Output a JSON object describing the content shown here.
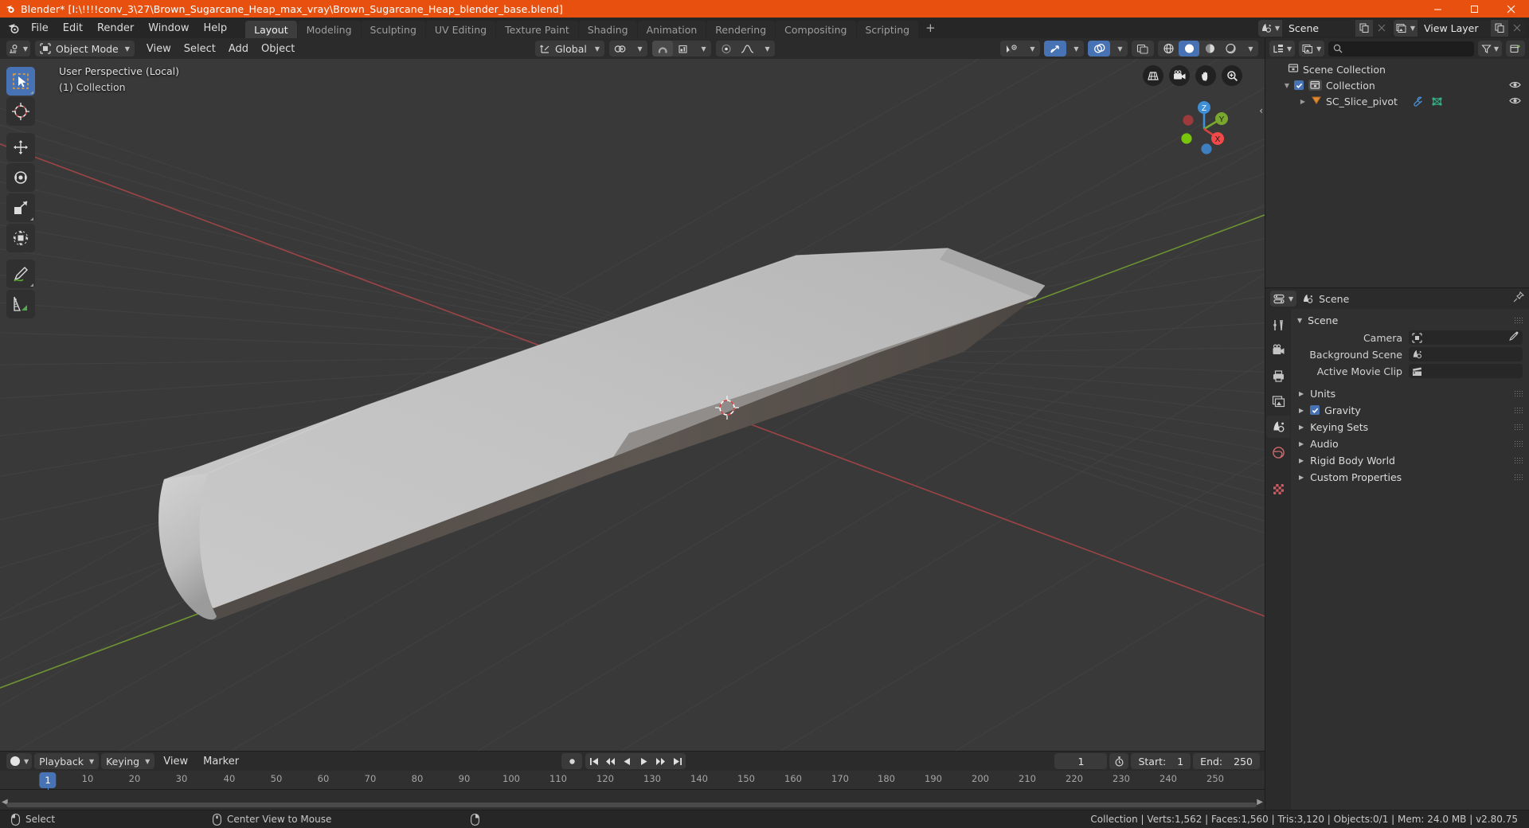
{
  "window": {
    "title": "Blender* [I:\\!!!!conv_3\\27\\Brown_Sugarcane_Heap_max_vray\\Brown_Sugarcane_Heap_blender_base.blend]",
    "minimize": "–",
    "maximize": "▢",
    "close": "✕"
  },
  "topbar": {
    "menus": [
      "File",
      "Edit",
      "Render",
      "Window",
      "Help"
    ],
    "workspaces": [
      {
        "label": "Layout",
        "active": true
      },
      {
        "label": "Modeling",
        "active": false
      },
      {
        "label": "Sculpting",
        "active": false
      },
      {
        "label": "UV Editing",
        "active": false
      },
      {
        "label": "Texture Paint",
        "active": false
      },
      {
        "label": "Shading",
        "active": false
      },
      {
        "label": "Animation",
        "active": false
      },
      {
        "label": "Rendering",
        "active": false
      },
      {
        "label": "Compositing",
        "active": false
      },
      {
        "label": "Scripting",
        "active": false
      }
    ],
    "add_workspace": "+",
    "scene_name": "Scene",
    "view_layer_name": "View Layer"
  },
  "viewport": {
    "mode": "Object Mode",
    "menus": [
      "View",
      "Select",
      "Add",
      "Object"
    ],
    "transform_orientation": "Global",
    "overlay_line1": "User Perspective (Local)",
    "overlay_line2": "(1) Collection",
    "gizmo_axes": [
      "X",
      "Y",
      "Z"
    ],
    "background_color": "#393939",
    "grid_color": "#4a4a4a",
    "x_axis_color": "#b34040",
    "y_axis_color": "#6e9e2e",
    "object_light_color": "#c3c3c3",
    "object_dark_color": "#58524e",
    "cursor_label": "3d-cursor"
  },
  "outliner": {
    "search_placeholder": "",
    "rows": [
      {
        "label": "Scene Collection",
        "indent": 0,
        "icon": "collection-icon",
        "has_eye": false,
        "has_checkbox": false,
        "has_disclosure": false
      },
      {
        "label": "Collection",
        "indent": 1,
        "icon": "collection-icon",
        "has_eye": true,
        "has_checkbox": true,
        "has_disclosure": true
      },
      {
        "label": "SC_Slice_pivot",
        "indent": 2,
        "icon": "empty-axes-icon",
        "has_eye": true,
        "has_checkbox": false,
        "has_disclosure": true,
        "extra_icons": [
          "modifier-wrench-icon",
          "mesh-data-icon"
        ]
      }
    ]
  },
  "properties": {
    "breadcrumb": "Scene",
    "panel_title": "Scene",
    "fields": [
      {
        "label": "Camera",
        "value": "",
        "icon": "camera-data-icon",
        "has_eyedropper": true
      },
      {
        "label": "Background Scene",
        "value": "",
        "icon": "scene-icon",
        "has_eyedropper": false
      },
      {
        "label": "Active Movie Clip",
        "value": "",
        "icon": "movie-clip-icon",
        "has_eyedropper": false
      }
    ],
    "panels": [
      {
        "label": "Units",
        "checkbox": null
      },
      {
        "label": "Gravity",
        "checkbox": true
      },
      {
        "label": "Keying Sets",
        "checkbox": null
      },
      {
        "label": "Audio",
        "checkbox": null
      },
      {
        "label": "Rigid Body World",
        "checkbox": null
      },
      {
        "label": "Custom Properties",
        "checkbox": null
      }
    ],
    "tabs": [
      "tool-icon",
      "render-icon",
      "output-icon",
      "view-layer-icon",
      "scene-icon",
      "world-icon",
      "texture-icon"
    ]
  },
  "timeline": {
    "menus": [
      "Playback",
      "Keying",
      "View",
      "Marker"
    ],
    "current_frame": "1",
    "start_label": "Start:",
    "start_value": "1",
    "end_label": "End:",
    "end_value": "250",
    "ticks": [
      "10",
      "20",
      "30",
      "40",
      "50",
      "60",
      "70",
      "80",
      "90",
      "100",
      "110",
      "120",
      "130",
      "140",
      "150",
      "160",
      "170",
      "180",
      "190",
      "200",
      "210",
      "220",
      "230",
      "240",
      "250"
    ],
    "playhead_label": "1"
  },
  "statusbar": {
    "left_items": [
      {
        "icon": "mouse-left-icon",
        "label": "Select"
      },
      {
        "icon": "mouse-middle-icon",
        "label": "Center View to Mouse"
      },
      {
        "icon": "mouse-right-icon",
        "label": ""
      }
    ],
    "stats": "Collection | Verts:1,562 | Faces:1,560 | Tris:3,120 | Objects:0/1 | Mem: 24.0 MB | v2.80.75"
  },
  "colors": {
    "accent_blue": "#4772b3",
    "title_orange": "#e8500f",
    "panel_bg": "#303030",
    "header_bg": "#2b2b2b"
  }
}
